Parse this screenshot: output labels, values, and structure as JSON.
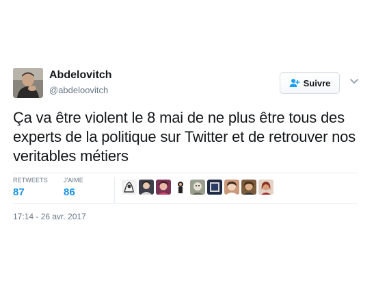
{
  "author": {
    "display_name": "Abdelovitch",
    "handle": "@abdeloovitch",
    "avatar_icon": "profile-photo"
  },
  "follow_button": {
    "label": "Suivre",
    "icon": "add-user-icon",
    "accent": "#1da1f2"
  },
  "menu": {
    "icon": "chevron-down-icon"
  },
  "tweet": {
    "text": "Ça va être violent le 8 mai de ne plus être tous des experts de la politique sur Twitter et de retrouver nos veritables métiers"
  },
  "stats": {
    "retweets_label": "RETWEETS",
    "retweets_count": "87",
    "likes_label": "J'AIME",
    "likes_count": "86",
    "count_color": "#1c94e0"
  },
  "likers": {
    "count_shown": 10,
    "icon": "user-avatar-icon"
  },
  "timestamp": "17:14 - 26 avr. 2017"
}
